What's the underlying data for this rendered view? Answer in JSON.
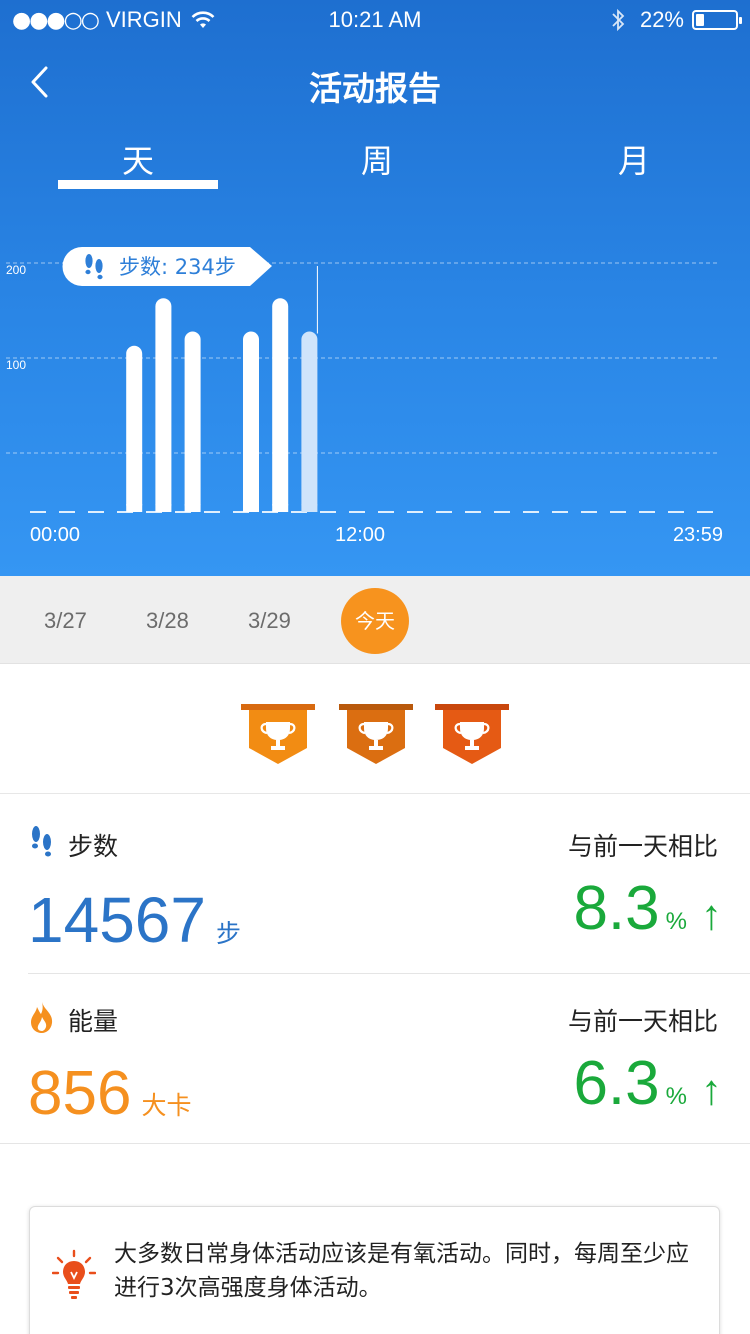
{
  "status_bar": {
    "signal": "●●●○○",
    "carrier": "VIRGIN",
    "time": "10:21 AM",
    "battery": "22%",
    "battery_level": 0.22
  },
  "nav": {
    "title": "活动报告"
  },
  "tabs": [
    {
      "label": "天",
      "active": true
    },
    {
      "label": "周",
      "active": false
    },
    {
      "label": "月",
      "active": false
    }
  ],
  "chart_data": {
    "type": "bar",
    "title": "",
    "xlabel": "",
    "ylabel": "",
    "ylim": [
      0,
      320
    ],
    "yticks": [
      100,
      200,
      300
    ],
    "x_tick_labels": [
      "00:00",
      "12:00",
      "23:59"
    ],
    "categories": [
      "0",
      "1",
      "2",
      "3",
      "4",
      "5",
      "6",
      "7",
      "8",
      "9",
      "10",
      "11",
      "12",
      "13",
      "14",
      "15",
      "16",
      "17",
      "18",
      "19",
      "20",
      "21",
      "22",
      "23"
    ],
    "values": [
      0,
      0,
      0,
      175,
      225,
      190,
      0,
      190,
      225,
      190,
      0,
      0,
      0,
      0,
      0,
      0,
      0,
      0,
      0,
      0,
      0,
      0,
      0,
      0
    ],
    "highlighted_index": 9,
    "tooltip": "步数: 234步",
    "grid": true,
    "colors": {
      "bar": "#ffffff",
      "bar_highlight": "#cfe4fb",
      "tooltip_text": "#2e7fd8"
    }
  },
  "dates": {
    "items": [
      "3/27",
      "3/28",
      "3/29"
    ],
    "today": "今天"
  },
  "trophies": [
    {
      "name": "trophy-gold",
      "color": "#f28c13"
    },
    {
      "name": "trophy-bronze",
      "color": "#db6e11"
    },
    {
      "name": "trophy-red",
      "color": "#e55a14"
    }
  ],
  "steps": {
    "label": "步数",
    "compare_label": "与前一天相比",
    "value": "14567",
    "unit": "步",
    "percent": "8.3",
    "percent_sign": "%",
    "arrow": "↑",
    "color": "#2b74c7"
  },
  "energy": {
    "label": "能量",
    "compare_label": "与前一天相比",
    "value": "856",
    "unit": "大卡",
    "percent": "6.3",
    "percent_sign": "%",
    "arrow": "↑",
    "color": "#f5901f"
  },
  "tip": {
    "text": "大多数日常身体活动应该是有氧活动。同时，每周至少应进行3次高强度身体活动。"
  }
}
